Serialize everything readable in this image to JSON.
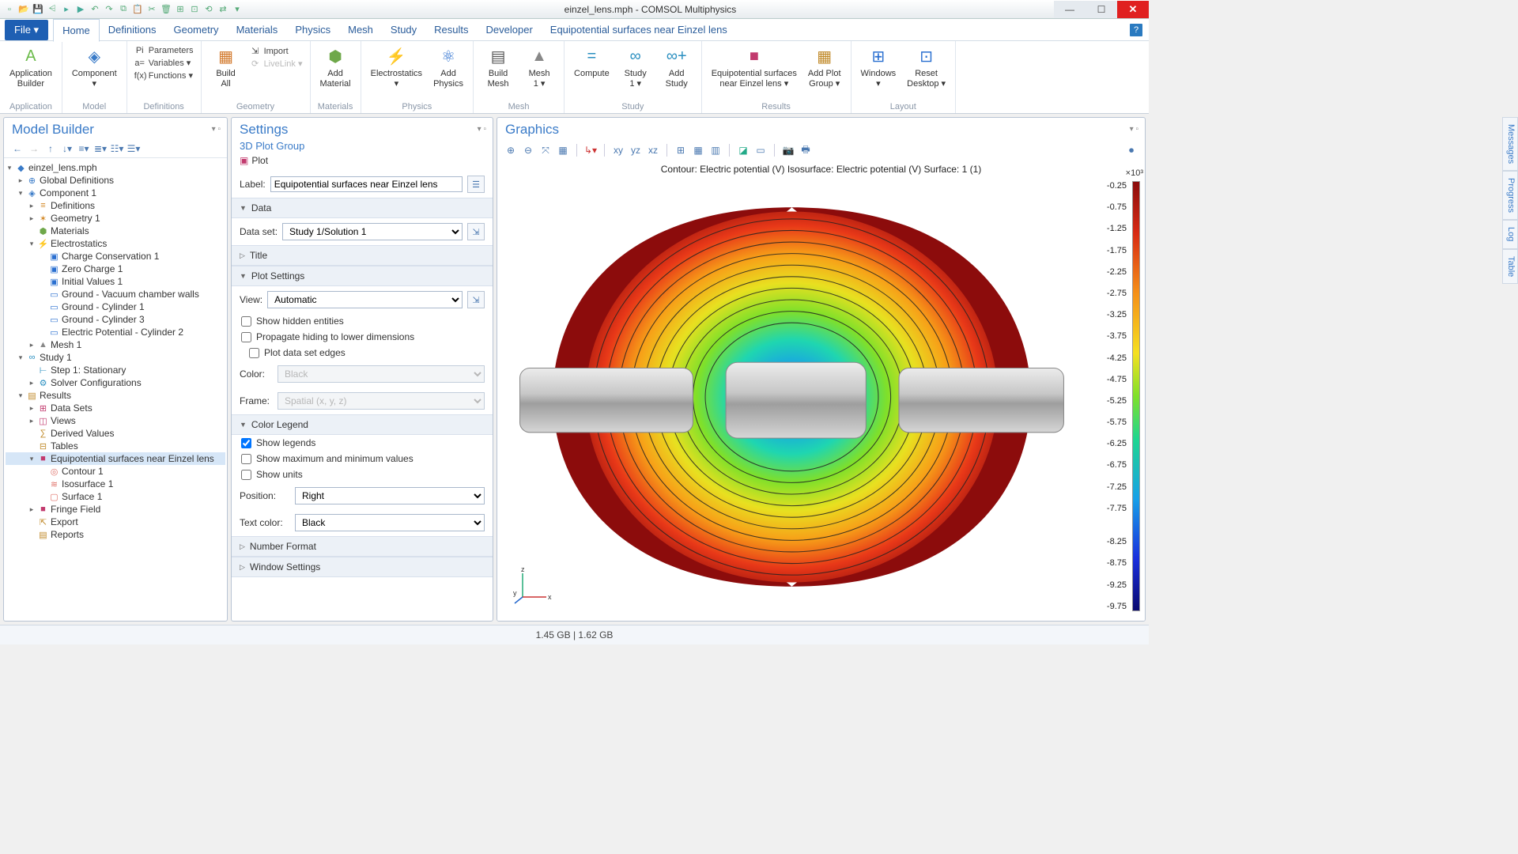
{
  "window": {
    "title": "einzel_lens.mph - COMSOL Multiphysics"
  },
  "qat_icons": [
    "new-doc",
    "open",
    "save",
    "save-all",
    "undo-arrow",
    "run",
    "undo",
    "redo",
    "copy",
    "paste",
    "cut",
    "delete",
    "tile",
    "cascade",
    "reset",
    "sync",
    "dropdown"
  ],
  "menu": {
    "file": "File ▾",
    "tabs": [
      "Home",
      "Definitions",
      "Geometry",
      "Materials",
      "Physics",
      "Mesh",
      "Study",
      "Results",
      "Developer",
      "Equipotential surfaces near Einzel lens"
    ],
    "active": "Home"
  },
  "ribbon": {
    "groups": [
      {
        "label": "Application",
        "items": [
          {
            "t": "big",
            "ico": "A",
            "color": "#6bbb4a",
            "lbl": "Application\nBuilder"
          }
        ]
      },
      {
        "label": "Model",
        "items": [
          {
            "t": "big",
            "ico": "◈",
            "color": "#3a7bc8",
            "lbl": "Component\n▾"
          }
        ]
      },
      {
        "label": "Definitions",
        "items": [
          {
            "t": "small",
            "rows": [
              {
                "ico": "Pi",
                "lbl": "Parameters"
              },
              {
                "ico": "a=",
                "lbl": "Variables ▾"
              },
              {
                "ico": "f(x)",
                "lbl": "Functions ▾"
              }
            ]
          }
        ]
      },
      {
        "label": "Geometry",
        "items": [
          {
            "t": "big",
            "ico": "▦",
            "color": "#d37a2d",
            "lbl": "Build\nAll"
          },
          {
            "t": "small",
            "rows": [
              {
                "ico": "⇲",
                "lbl": "Import"
              },
              {
                "ico": "⟳",
                "lbl": "LiveLink ▾",
                "dis": true
              }
            ]
          }
        ]
      },
      {
        "label": "Materials",
        "items": [
          {
            "t": "big",
            "ico": "⬢",
            "color": "#6fa84a",
            "lbl": "Add\nMaterial"
          }
        ]
      },
      {
        "label": "Physics",
        "items": [
          {
            "t": "big",
            "ico": "⚡",
            "color": "#2a6fd0",
            "lbl": "Electrostatics\n▾"
          },
          {
            "t": "big",
            "ico": "⚛",
            "color": "#2a6fd0",
            "lbl": "Add\nPhysics"
          }
        ]
      },
      {
        "label": "Mesh",
        "items": [
          {
            "t": "big",
            "ico": "▤",
            "color": "#555",
            "lbl": "Build\nMesh"
          },
          {
            "t": "big",
            "ico": "▲",
            "color": "#888",
            "lbl": "Mesh\n1 ▾"
          }
        ]
      },
      {
        "label": "Study",
        "items": [
          {
            "t": "big",
            "ico": "=",
            "color": "#2a8fc0",
            "lbl": "Compute"
          },
          {
            "t": "big",
            "ico": "∞",
            "color": "#2a8fc0",
            "lbl": "Study\n1 ▾"
          },
          {
            "t": "big",
            "ico": "∞+",
            "color": "#2a8fc0",
            "lbl": "Add\nStudy"
          }
        ]
      },
      {
        "label": "Results",
        "items": [
          {
            "t": "big",
            "ico": "■",
            "color": "#c23a6e",
            "lbl": "Equipotential surfaces\nnear Einzel lens ▾"
          },
          {
            "t": "big",
            "ico": "▦",
            "color": "#c08a2a",
            "lbl": "Add Plot\nGroup ▾"
          }
        ]
      },
      {
        "label": "Layout",
        "items": [
          {
            "t": "big",
            "ico": "⊞",
            "color": "#2a6fd0",
            "lbl": "Windows\n▾"
          },
          {
            "t": "big",
            "ico": "⊡",
            "color": "#2a6fd0",
            "lbl": "Reset\nDesktop ▾"
          }
        ]
      }
    ]
  },
  "model_builder": {
    "title": "Model Builder",
    "tree": [
      {
        "d": 0,
        "tw": "▾",
        "ico": "◆",
        "c": "#3a7bc8",
        "lbl": "einzel_lens.mph"
      },
      {
        "d": 1,
        "tw": "▸",
        "ico": "⊕",
        "c": "#3a7bc8",
        "lbl": "Global Definitions"
      },
      {
        "d": 1,
        "tw": "▾",
        "ico": "◈",
        "c": "#3a7bc8",
        "lbl": "Component 1"
      },
      {
        "d": 2,
        "tw": "▸",
        "ico": "≡",
        "c": "#d48a2a",
        "lbl": "Definitions"
      },
      {
        "d": 2,
        "tw": "▸",
        "ico": "✶",
        "c": "#d48a2a",
        "lbl": "Geometry 1"
      },
      {
        "d": 2,
        "tw": "",
        "ico": "⬢",
        "c": "#6fa84a",
        "lbl": "Materials"
      },
      {
        "d": 2,
        "tw": "▾",
        "ico": "⚡",
        "c": "#2a6fd0",
        "lbl": "Electrostatics"
      },
      {
        "d": 3,
        "tw": "",
        "ico": "▣",
        "c": "#2a6fd0",
        "lbl": "Charge Conservation 1"
      },
      {
        "d": 3,
        "tw": "",
        "ico": "▣",
        "c": "#2a6fd0",
        "lbl": "Zero Charge 1"
      },
      {
        "d": 3,
        "tw": "",
        "ico": "▣",
        "c": "#2a6fd0",
        "lbl": "Initial Values 1"
      },
      {
        "d": 3,
        "tw": "",
        "ico": "▭",
        "c": "#2a6fd0",
        "lbl": "Ground - Vacuum chamber walls"
      },
      {
        "d": 3,
        "tw": "",
        "ico": "▭",
        "c": "#2a6fd0",
        "lbl": "Ground - Cylinder 1"
      },
      {
        "d": 3,
        "tw": "",
        "ico": "▭",
        "c": "#2a6fd0",
        "lbl": "Ground - Cylinder 3"
      },
      {
        "d": 3,
        "tw": "",
        "ico": "▭",
        "c": "#2a6fd0",
        "lbl": "Electric Potential - Cylinder 2"
      },
      {
        "d": 2,
        "tw": "▸",
        "ico": "▲",
        "c": "#888",
        "lbl": "Mesh 1"
      },
      {
        "d": 1,
        "tw": "▾",
        "ico": "∞",
        "c": "#2a8fc0",
        "lbl": "Study 1"
      },
      {
        "d": 2,
        "tw": "",
        "ico": "⊢",
        "c": "#2a8fc0",
        "lbl": "Step 1: Stationary"
      },
      {
        "d": 2,
        "tw": "▸",
        "ico": "⚙",
        "c": "#2a8fc0",
        "lbl": "Solver Configurations"
      },
      {
        "d": 1,
        "tw": "▾",
        "ico": "▤",
        "c": "#c08a2a",
        "lbl": "Results"
      },
      {
        "d": 2,
        "tw": "▸",
        "ico": "⊞",
        "c": "#c23a6e",
        "lbl": "Data Sets"
      },
      {
        "d": 2,
        "tw": "▸",
        "ico": "◫",
        "c": "#c23a6e",
        "lbl": "Views"
      },
      {
        "d": 2,
        "tw": "",
        "ico": "∑",
        "c": "#c08a2a",
        "lbl": "Derived Values"
      },
      {
        "d": 2,
        "tw": "",
        "ico": "⊟",
        "c": "#c08a2a",
        "lbl": "Tables"
      },
      {
        "d": 2,
        "tw": "▾",
        "ico": "■",
        "c": "#c23a6e",
        "lbl": "Equipotential surfaces near Einzel lens",
        "sel": true
      },
      {
        "d": 3,
        "tw": "",
        "ico": "◎",
        "c": "#e0736b",
        "lbl": "Contour 1"
      },
      {
        "d": 3,
        "tw": "",
        "ico": "≋",
        "c": "#e0736b",
        "lbl": "Isosurface 1"
      },
      {
        "d": 3,
        "tw": "",
        "ico": "▢",
        "c": "#e0736b",
        "lbl": "Surface 1"
      },
      {
        "d": 2,
        "tw": "▸",
        "ico": "■",
        "c": "#c23a6e",
        "lbl": "Fringe Field"
      },
      {
        "d": 2,
        "tw": "",
        "ico": "⇱",
        "c": "#c08a2a",
        "lbl": "Export"
      },
      {
        "d": 2,
        "tw": "",
        "ico": "▤",
        "c": "#c08a2a",
        "lbl": "Reports"
      }
    ]
  },
  "settings": {
    "title": "Settings",
    "subtitle": "3D Plot Group",
    "plot_btn": "Plot",
    "label_lbl": "Label:",
    "label_val": "Equipotential surfaces near Einzel lens",
    "sections": {
      "data": "Data",
      "title": "Title",
      "plot_settings": "Plot Settings",
      "color_legend": "Color Legend",
      "number_format": "Number Format",
      "window_settings": "Window Settings"
    },
    "dataset_lbl": "Data set:",
    "dataset_val": "Study 1/Solution 1",
    "view_lbl": "View:",
    "view_val": "Automatic",
    "chk_hidden": "Show hidden entities",
    "chk_propagate": "Propagate hiding to lower dimensions",
    "chk_plotedges": "Plot data set edges",
    "color_lbl": "Color:",
    "color_val": "Black",
    "frame_lbl": "Frame:",
    "frame_val": "Spatial  (x, y, z)",
    "chk_showlegends": "Show legends",
    "chk_showmaxmin": "Show maximum and minimum values",
    "chk_showunits": "Show units",
    "position_lbl": "Position:",
    "position_val": "Right",
    "textcolor_lbl": "Text color:",
    "textcolor_val": "Black"
  },
  "graphics": {
    "title": "Graphics",
    "plot_title": "Contour: Electric potential (V)   Isosurface: Electric potential (V)   Surface: 1 (1)",
    "cb_exp": "×10³",
    "cb_vals": [
      "-0.25",
      "-0.75",
      "-1.25",
      "-1.75",
      "-2.25",
      "-2.75",
      "-3.25",
      "-3.75",
      "-4.25",
      "-4.75",
      "-5.25",
      "-5.75",
      "-6.25",
      "-6.75",
      "-7.25",
      "-7.75",
      "",
      "-8.25",
      "-8.75",
      "-9.25",
      "-9.75"
    ],
    "axes": {
      "x": "x",
      "y": "y",
      "z": "z"
    }
  },
  "right_tabs": [
    "Messages",
    "Progress",
    "Log",
    "Table"
  ],
  "status": "1.45 GB | 1.62 GB"
}
